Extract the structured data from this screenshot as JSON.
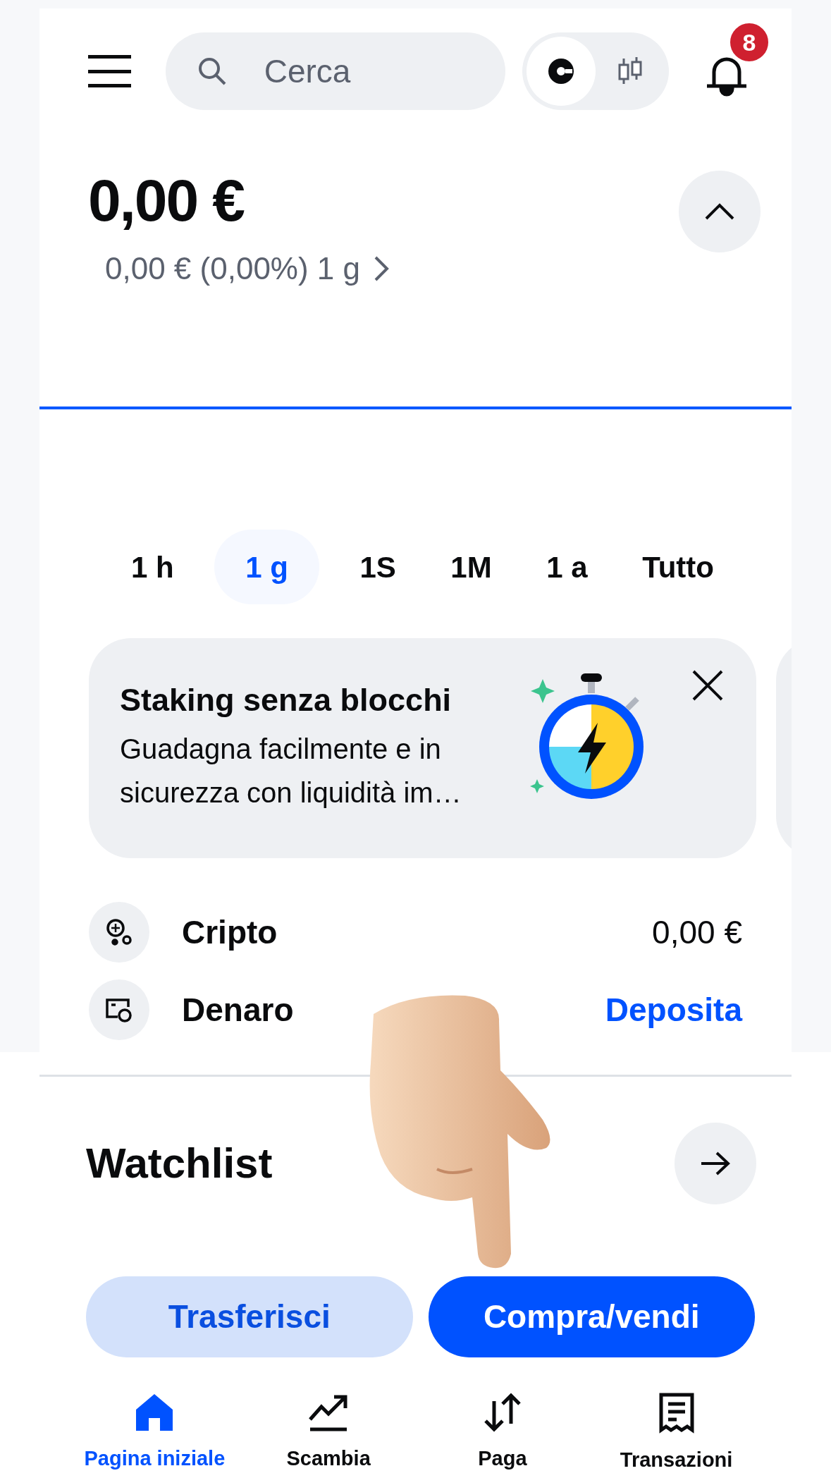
{
  "header": {
    "search": {
      "placeholder": "Cerca"
    },
    "view_toggle": [
      {
        "kind": "simple",
        "selected": true
      },
      {
        "kind": "advanced",
        "selected": false
      }
    ],
    "notifications_badge": "8"
  },
  "balance": {
    "amount": "0,00 €",
    "change": "0,00 € (0,00%) 1 g"
  },
  "time_ranges": [
    {
      "label": "1 h",
      "selected": false
    },
    {
      "label": "1 g",
      "selected": true
    },
    {
      "label": "1S",
      "selected": false
    },
    {
      "label": "1M",
      "selected": false
    },
    {
      "label": "1 a",
      "selected": false
    },
    {
      "label": "Tutto",
      "selected": false
    }
  ],
  "promo": {
    "title": "Staking senza blocchi",
    "body": "Guadagna facilmente e in sicurezza con liquidità im…"
  },
  "accounts": [
    {
      "kind": "crypto",
      "label": "Cripto",
      "value": "0,00 €"
    },
    {
      "kind": "cash",
      "label": "Denaro",
      "value": "Deposita"
    }
  ],
  "watchlist": {
    "title": "Watchlist"
  },
  "actions": [
    {
      "label": "Trasferisci",
      "kind": "secondary"
    },
    {
      "label": "Compra/vendi",
      "kind": "primary"
    }
  ],
  "bottom_nav": [
    {
      "kind": "home",
      "label": "Pagina iniziale",
      "selected": true
    },
    {
      "kind": "trade",
      "label": "Scambia",
      "selected": false
    },
    {
      "kind": "pay",
      "label": "Paga",
      "selected": false
    },
    {
      "kind": "transactions",
      "label": "Transazioni",
      "selected": false
    }
  ]
}
